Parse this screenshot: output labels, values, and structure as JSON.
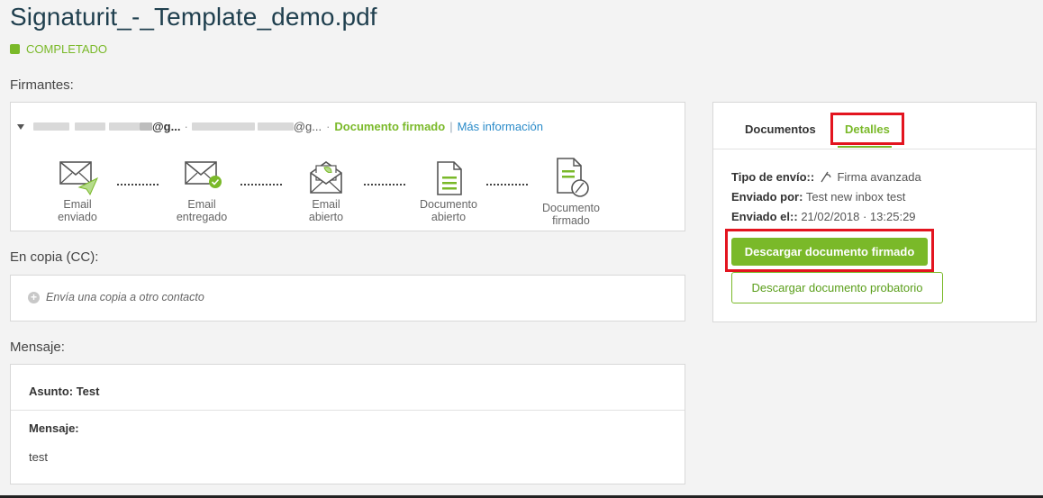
{
  "document": {
    "title": "Signaturit_-_Template_demo.pdf",
    "status": "COMPLETADO"
  },
  "signers": {
    "label": "Firmantes:",
    "email_suffix_1": "@g...",
    "email_suffix_2": "@g...",
    "status": "Documento firmado",
    "separator": "|",
    "more_info": "Más información",
    "steps": [
      {
        "label": "Email enviado"
      },
      {
        "label": "Email entregado"
      },
      {
        "label": "Email abierto"
      },
      {
        "label": "Documento abierto"
      },
      {
        "label": "Documento firmado"
      }
    ]
  },
  "cc": {
    "label": "En copia (CC):",
    "placeholder": "Envía una copia a otro contacto"
  },
  "message": {
    "label": "Mensaje:",
    "subject": "Asunto: Test",
    "body_label": "Mensaje:",
    "body": "test"
  },
  "panel": {
    "tabs": [
      "Documentos",
      "Detalles"
    ],
    "active_tab": "Detalles",
    "send_type_label": "Tipo de envío::",
    "send_type_value": "Firma avanzada",
    "sent_by_label": "Enviado por:",
    "sent_by_value": "Test new inbox test",
    "sent_on_label": "Enviado el::",
    "sent_on_value": "21/02/2018 · 13:25:29",
    "download_signed": "Descargar documento firmado",
    "download_evidence": "Descargar documento probatorio"
  },
  "colors": {
    "accent": "#7ab929",
    "link": "#2a8bc9",
    "highlight": "#e3141f",
    "title": "#1f3f4e"
  }
}
